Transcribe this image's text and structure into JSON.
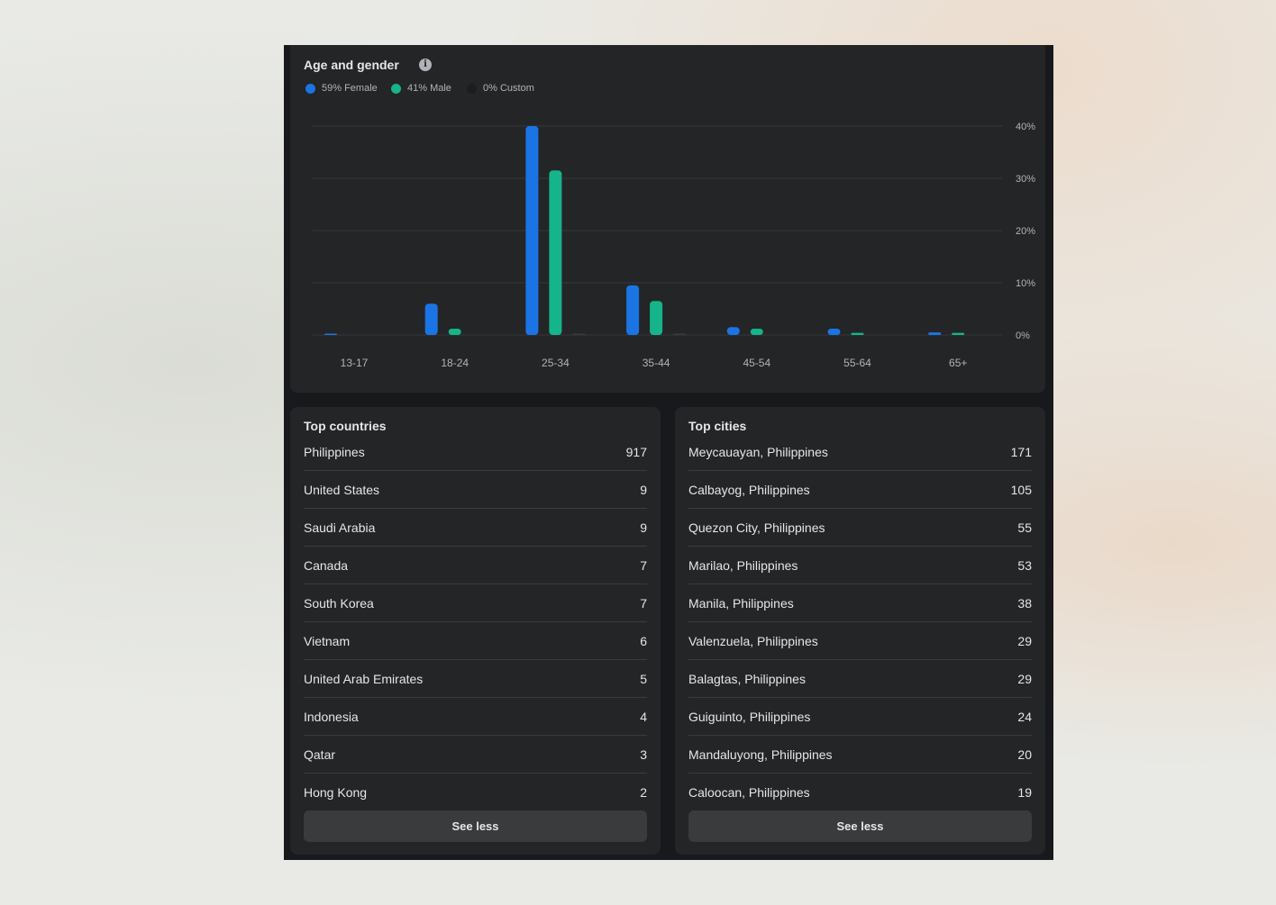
{
  "age_gender": {
    "title": "Age and gender",
    "info_icon": "info-icon",
    "legend": [
      {
        "label": "59% Female",
        "color": "#1b74e4"
      },
      {
        "label": "41% Male",
        "color": "#15b48a"
      },
      {
        "label": "0% Custom",
        "color": "#1c1d1f"
      }
    ]
  },
  "chart_data": {
    "type": "bar",
    "categories": [
      "13-17",
      "18-24",
      "25-34",
      "35-44",
      "45-54",
      "55-64",
      "65+"
    ],
    "series": [
      {
        "name": "Female",
        "color": "#1b74e4",
        "values": [
          0.2,
          6,
          40,
          9.5,
          1.5,
          1.2,
          0.5
        ]
      },
      {
        "name": "Male",
        "color": "#15b48a",
        "values": [
          0,
          1.2,
          31.5,
          6.5,
          1.2,
          0.4,
          0.4
        ]
      },
      {
        "name": "Custom",
        "color": "#3a3b3c",
        "values": [
          0,
          0,
          0.1,
          0.1,
          0,
          0,
          0
        ]
      }
    ],
    "ylim": [
      0,
      40
    ],
    "yticks": [
      "0%",
      "10%",
      "20%",
      "30%",
      "40%"
    ],
    "ytick_values": [
      0,
      10,
      20,
      30,
      40
    ],
    "grid": true
  },
  "countries": {
    "title": "Top countries",
    "rows": [
      {
        "name": "Philippines",
        "value": "917"
      },
      {
        "name": "United States",
        "value": "9"
      },
      {
        "name": "Saudi Arabia",
        "value": "9"
      },
      {
        "name": "Canada",
        "value": "7"
      },
      {
        "name": "South Korea",
        "value": "7"
      },
      {
        "name": "Vietnam",
        "value": "6"
      },
      {
        "name": "United Arab Emirates",
        "value": "5"
      },
      {
        "name": "Indonesia",
        "value": "4"
      },
      {
        "name": "Qatar",
        "value": "3"
      },
      {
        "name": "Hong Kong",
        "value": "2"
      }
    ],
    "button_label": "See less"
  },
  "cities": {
    "title": "Top cities",
    "rows": [
      {
        "name": "Meycauayan, Philippines",
        "value": "171"
      },
      {
        "name": "Calbayog, Philippines",
        "value": "105"
      },
      {
        "name": "Quezon City, Philippines",
        "value": "55"
      },
      {
        "name": "Marilao, Philippines",
        "value": "53"
      },
      {
        "name": "Manila, Philippines",
        "value": "38"
      },
      {
        "name": "Valenzuela, Philippines",
        "value": "29"
      },
      {
        "name": "Balagtas, Philippines",
        "value": "29"
      },
      {
        "name": "Guiguinto, Philippines",
        "value": "24"
      },
      {
        "name": "Mandaluyong, Philippines",
        "value": "20"
      },
      {
        "name": "Caloocan, Philippines",
        "value": "19"
      }
    ],
    "button_label": "See less"
  }
}
